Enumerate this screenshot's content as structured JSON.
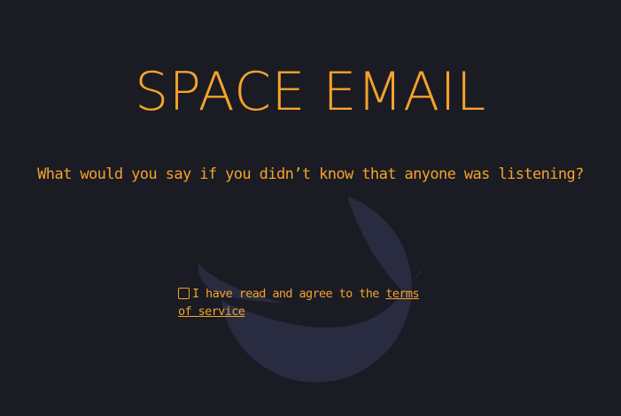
{
  "app": {
    "title": "SPACE EMAIL",
    "question": "What would you say if you didn’t know that anyone was listening?"
  },
  "agreement": {
    "checked": false,
    "prefix": "I have read and agree to the ",
    "link_label": "terms of service"
  },
  "colors": {
    "background": "#1a1b23",
    "accent": "#f5a32c",
    "moon": "#292b40"
  },
  "icons": {
    "moon": "crescent-moon-icon"
  }
}
